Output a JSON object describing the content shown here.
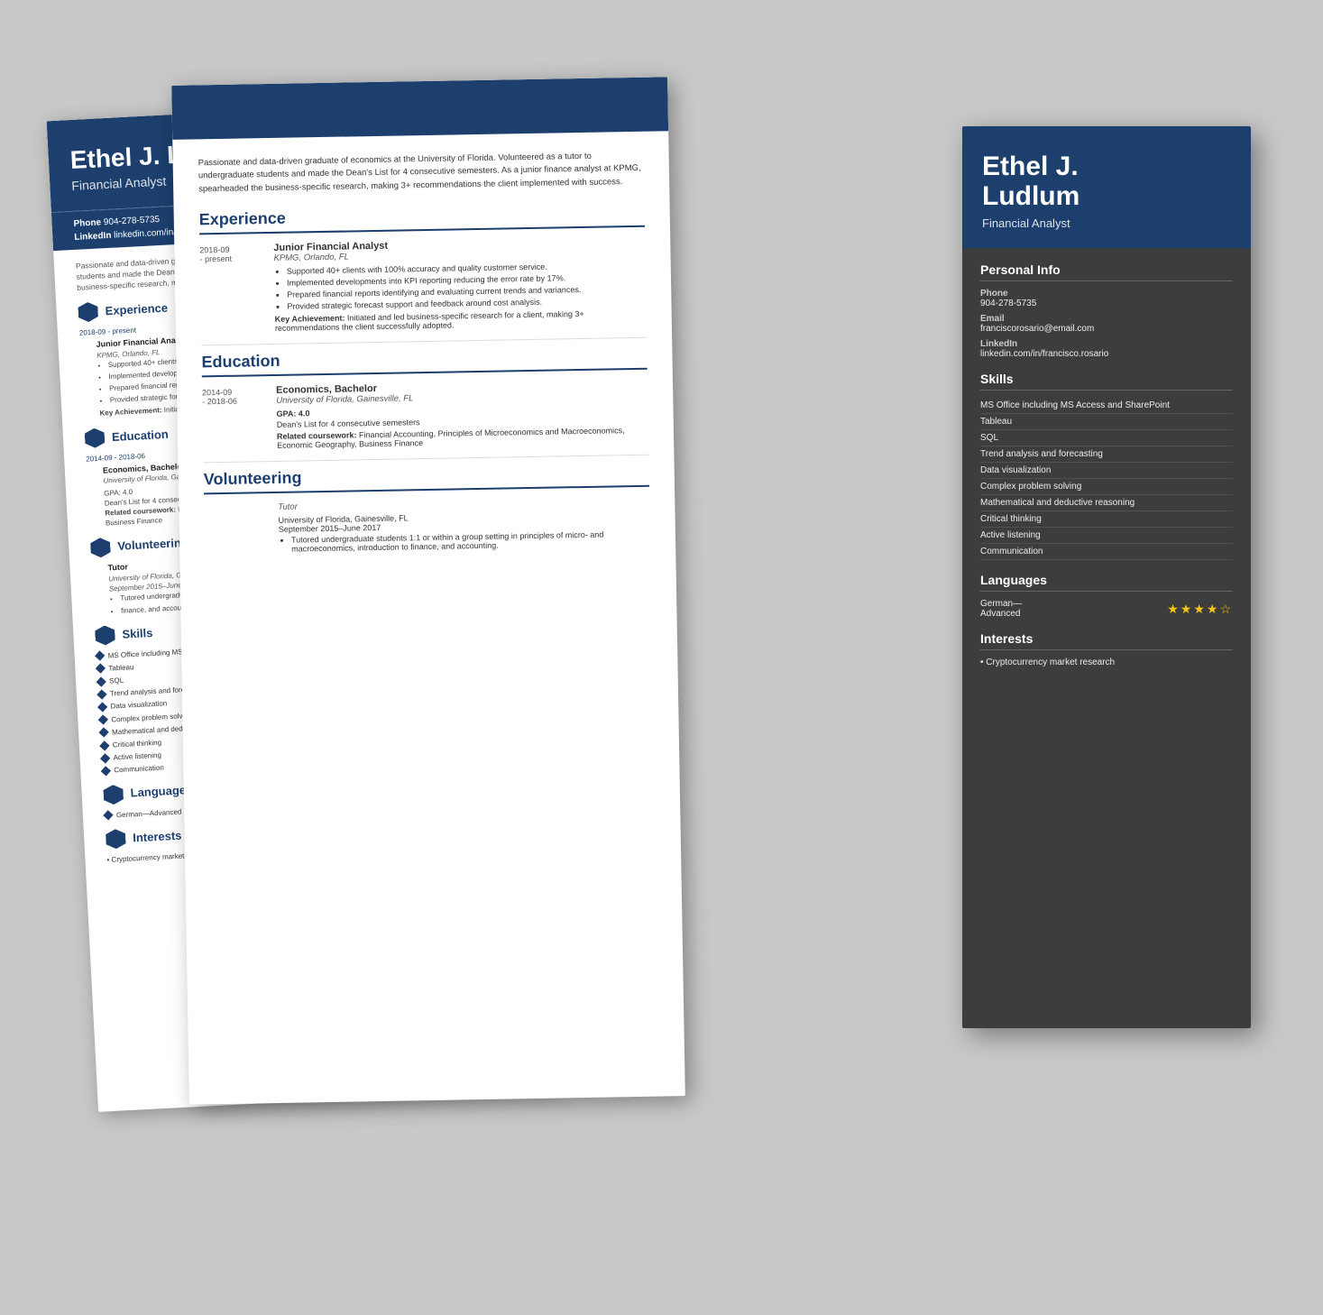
{
  "person": {
    "name_line1": "Ethel J.",
    "name_line2": "Ludlum",
    "name_full": "Ethel J. Ludlum",
    "title": "Financial Analyst",
    "phone": "904-278-5735",
    "email": "franciscorosario@email.com",
    "linkedin": "linkedin.com/in/francisco.rosario"
  },
  "summary": "Passionate and data-driven graduate of economics at the University of Florida. Volunteered as a tutor to undergraduate students and made the Dean's List for 4 consecutive semesters. As a junior finance analyst at KPMG, spearheaded the business-specific research, making 3+ recommendations the client implemented with success.",
  "experience": {
    "section_title": "Experience",
    "jobs": [
      {
        "title": "Junior Financial Analyst",
        "company": "KPMG, Orlando, FL",
        "date_start": "2018-09",
        "date_end": "present",
        "bullets": [
          "Supported 40+ clients with 100% accuracy and quality customer service.",
          "Implemented developments into KPI reporting reducing the error rate by 17%.",
          "Prepared financial reports identifying and evaluating current trends and variances.",
          "Provided strategic forecast support and feedback around cost analysis."
        ],
        "key_achievement": "Initiated and led business-specific research for a client, making 3+ recommendations the client successfully adopted."
      }
    ]
  },
  "education": {
    "section_title": "Education",
    "entries": [
      {
        "degree": "Economics, Bachelor",
        "institution": "University of Florida, Gainesville, FL",
        "date_start": "2014-09",
        "date_end": "2018-06",
        "gpa": "GPA: 4.0",
        "deans_list": "Dean's List for 4 consecutive semesters",
        "related_coursework_label": "Related coursework:",
        "coursework": "Financial Accounting, Principles of Microeconomics and Macroeconomics, Economic Geography, Business Finance"
      }
    ]
  },
  "volunteering": {
    "section_title": "Volunteering",
    "entries": [
      {
        "role": "Tutor",
        "org": "University of Florida, Gainesville, FL",
        "dates": "September 2015–June 2017",
        "bullets": [
          "Tutored undergraduate students 1:1 or within a group setting in principles of micro- and macroeconomics, introduction to finance, and accounting."
        ]
      }
    ]
  },
  "skills": {
    "section_title": "Skills",
    "items": [
      "MS Office including MS Access and SharePoint",
      "Tableau",
      "SQL",
      "Trend analysis and forecasting",
      "Data visualization",
      "Complex problem solving",
      "Mathematical and deductive reasoning",
      "Critical thinking",
      "Active listening",
      "Communication"
    ]
  },
  "languages": {
    "section_title": "Languages",
    "items": [
      {
        "name": "German—Advanced",
        "stars": 4,
        "max_stars": 5
      }
    ]
  },
  "interests": {
    "section_title": "Interests",
    "items": [
      "Cryptocurrency market research"
    ]
  },
  "contact_labels": {
    "phone": "Phone",
    "email": "Email",
    "linkedin": "LinkedIn"
  },
  "personal_info_title": "Personal Info"
}
